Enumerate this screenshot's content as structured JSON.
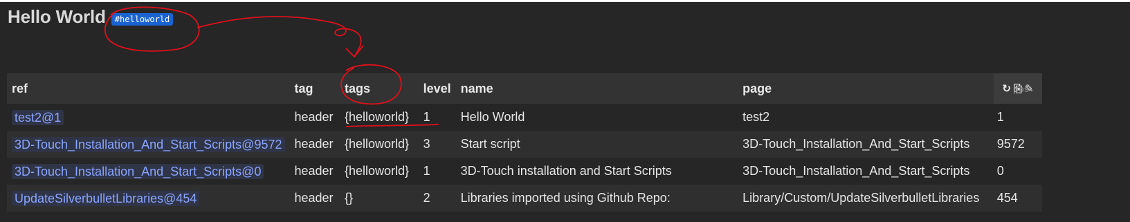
{
  "page_title": "Hello World",
  "tag_badge": "#helloworld",
  "table": {
    "columns": [
      "ref",
      "tag",
      "tags",
      "level",
      "name",
      "page"
    ],
    "pos_column": "pos",
    "rows": [
      {
        "ref": "test2@1",
        "tag": "header",
        "tags": "{helloworld}",
        "level": "1",
        "name": "Hello World",
        "page": "test2",
        "pos": "1"
      },
      {
        "ref": "3D-Touch_Installation_And_Start_Scripts@9572",
        "tag": "header",
        "tags": "{helloworld}",
        "level": "3",
        "name": "Start script",
        "page": "3D-Touch_Installation_And_Start_Scripts",
        "pos": "9572"
      },
      {
        "ref": "3D-Touch_Installation_And_Start_Scripts@0",
        "tag": "header",
        "tags": "{helloworld}",
        "level": "1",
        "name": "3D-Touch installation and Start Scripts",
        "page": "3D-Touch_Installation_And_Start_Scripts",
        "pos": "0"
      },
      {
        "ref": "UpdateSilverbulletLibraries@454",
        "tag": "header",
        "tags": "{}",
        "level": "2",
        "name": "Libraries imported using Github Repo:",
        "page": "Library/Custom/UpdateSilverbulletLibraries",
        "pos": "454"
      }
    ]
  },
  "toolbar_icons": [
    "refresh-icon",
    "copy-icon",
    "edit-icon"
  ],
  "colors": {
    "background": "#262626",
    "header_bg": "#333333",
    "link": "#8aa5ff",
    "badge": "#1a63d1",
    "annotation": "#e0101b"
  }
}
